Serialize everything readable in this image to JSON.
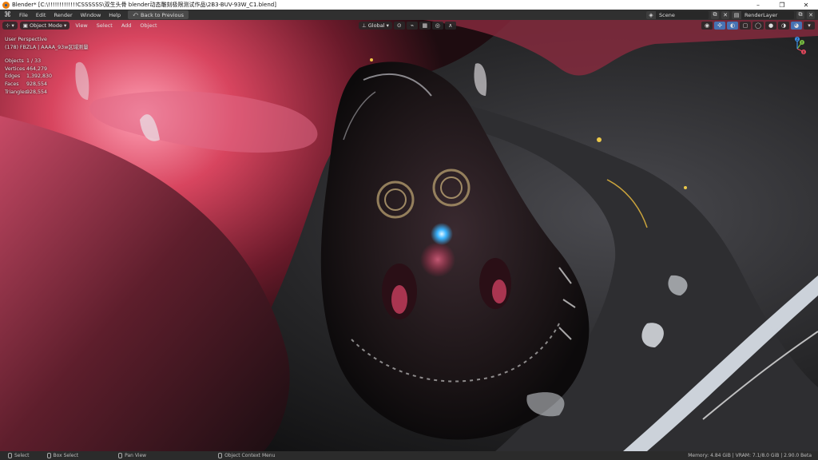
{
  "window": {
    "title": "Blender* [C:\\!!!!!!!!!!!!!CSSSSSS\\双生头骨 blender动态雕刻极限测试作品\\2B3-BUV-93W_C1.blend]",
    "minimize": "–",
    "maximize": "❐",
    "close": "✕"
  },
  "menubar": {
    "logo": "⌘",
    "items": [
      "File",
      "Edit",
      "Render",
      "Window",
      "Help"
    ],
    "back_button": "Back to Previous",
    "scene_label": "Scene",
    "view_layer_label": "RenderLayer"
  },
  "viewport": {
    "editor_type_icon": "⊹",
    "mode": "Object Mode",
    "menus": [
      "View",
      "Select",
      "Add",
      "Object"
    ],
    "transform_orientation": "Global",
    "info": {
      "perspective": "User Perspective",
      "collection": "(178) FBZLA | AAAA_93w区域测量",
      "stats": [
        {
          "label": "Objects",
          "value": "1 / 33"
        },
        {
          "label": "Vertices",
          "value": "464,279"
        },
        {
          "label": "Edges",
          "value": "1,392,830"
        },
        {
          "label": "Faces",
          "value": "928,554"
        },
        {
          "label": "Triangles",
          "value": "928,554"
        }
      ]
    },
    "gizmo_axes": {
      "x": "X",
      "y": "Y",
      "z": "Z"
    }
  },
  "statusbar": {
    "select": "Select",
    "box_select": "Box Select",
    "pan_view": "Pan View",
    "context_menu": "Object Context Menu",
    "memory": "Memory: 4.84 GiB | VRAM: 7.1/8.0 GiB | 2.90.0 Beta"
  },
  "colors": {
    "accent": "#4772b3",
    "pink_light": "#ff6f93",
    "glow_blue": "#3ab4ff"
  }
}
